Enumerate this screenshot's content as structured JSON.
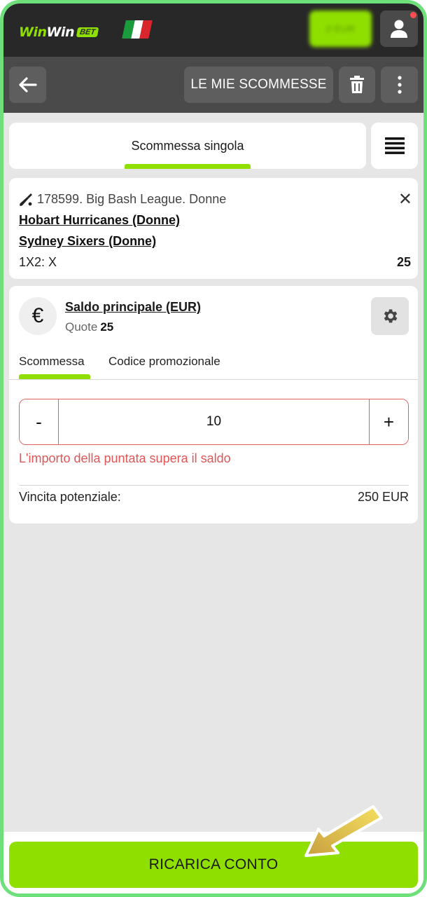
{
  "header": {
    "logo_text_1": "Win",
    "logo_text_2": "Win",
    "logo_badge": "BET",
    "balance_label": "0 EUR",
    "flag_colors": [
      "#1a9b3c",
      "#ffffff",
      "#d9252c"
    ]
  },
  "toolbar": {
    "back_icon": "arrow-left-icon",
    "my_bets_label": "LE MIE SCOMMESSE",
    "trash_icon": "trash-icon",
    "more_icon": "more-vertical-icon"
  },
  "tabs": {
    "active_label": "Scommessa singola",
    "list_icon": "list-icon"
  },
  "event": {
    "league": "178599. Big Bash League. Donne",
    "team1": "Hobart Hurricanes (Donne)",
    "team2": "Sydney Sixers (Donne)",
    "market": "1X2: X",
    "odds": "25",
    "close_symbol": "✕"
  },
  "stake": {
    "currency_symbol": "€",
    "balance_name": "Saldo principale (EUR)",
    "quote_label": "Quote",
    "quote_value": "25",
    "subtab_bet": "Scommessa",
    "subtab_promo": "Codice promozionale",
    "minus_label": "-",
    "plus_label": "+",
    "amount": "10",
    "error": "L'importo della puntata supera il saldo",
    "potential_win_label": "Vincita potenziale:",
    "potential_win_value": "250 EUR"
  },
  "footer": {
    "recharge_label": "RICARICA CONTO"
  },
  "colors": {
    "accent_green": "#8fe000",
    "header_dark": "#282828",
    "toolbar_gray": "#4a4a4a",
    "error_red": "#e05555",
    "frame_green": "#6ee07a"
  }
}
